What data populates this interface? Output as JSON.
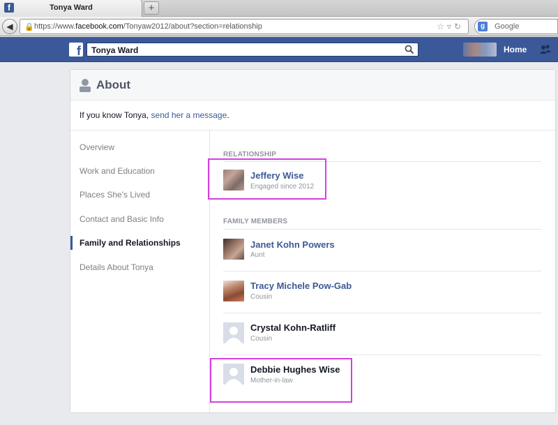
{
  "browser": {
    "tab_title": "Tonya Ward",
    "new_tab_label": "+",
    "url_prefix": "https://www.",
    "url_domain": "facebook.com",
    "url_path": "/Tonyaw2012/about?section=relationship",
    "search_engine": "Google"
  },
  "fb_header": {
    "search_value": "Tonya Ward",
    "home_label": "Home"
  },
  "about": {
    "title": "About",
    "intro_text": "If you know Tonya, ",
    "intro_link": "send her a message",
    "intro_end": "."
  },
  "sidebar": {
    "items": [
      {
        "label": "Overview"
      },
      {
        "label": "Work and Education"
      },
      {
        "label": "Places She's Lived"
      },
      {
        "label": "Contact and Basic Info"
      },
      {
        "label": "Family and Relationships",
        "active": true
      },
      {
        "label": "Details About Tonya"
      }
    ]
  },
  "relationship": {
    "heading": "RELATIONSHIP",
    "name": "Jeffery Wise",
    "status": "Engaged since 2012"
  },
  "family": {
    "heading": "FAMILY MEMBERS",
    "members": [
      {
        "name": "Janet Kohn Powers",
        "relation": "Aunt"
      },
      {
        "name": "Tracy Michele Pow-Gab",
        "relation": "Cousin"
      },
      {
        "name": "Crystal Kohn-Ratliff",
        "relation": "Cousin"
      },
      {
        "name": "Debbie Hughes Wise",
        "relation": "Mother-in-law"
      }
    ]
  },
  "colors": {
    "fb_blue": "#3b5998",
    "highlight": "#d43fe0",
    "page_bg": "#e9eaed"
  },
  "icons": {
    "back": "back-arrow-icon",
    "lock": "lock-icon",
    "fb_logo": "facebook-logo",
    "search": "search-icon",
    "friends": "friends-icon",
    "about": "person-icon"
  }
}
